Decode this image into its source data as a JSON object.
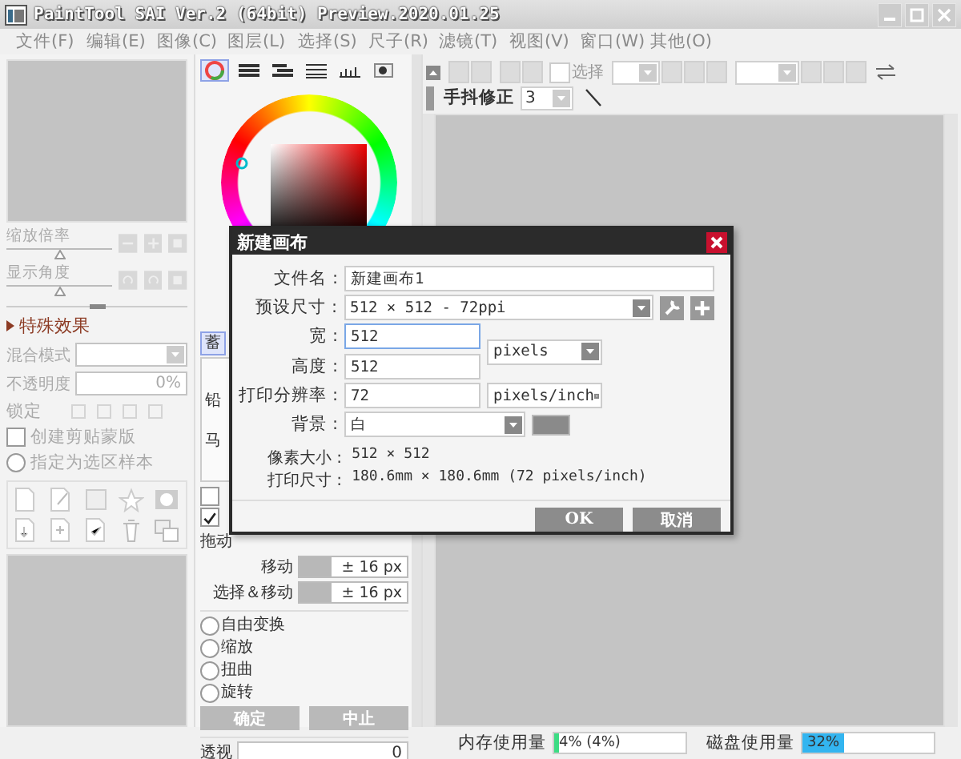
{
  "window": {
    "title": "PaintTool SAI Ver.2 (64bit) Preview.2020.01.25"
  },
  "menu": [
    "文件(F)",
    "编辑(E)",
    "图像(C)",
    "图层(L)",
    "选择(S)",
    "尺子(R)",
    "滤镜(T)",
    "视图(V)",
    "窗口(W)",
    "其他(O)"
  ],
  "navigator": {
    "sliders": [
      {
        "label": "缩放倍率",
        "level": 0.5
      },
      {
        "label": "显示角度",
        "level": 0.5
      }
    ]
  },
  "layer_panel": {
    "section": "特殊效果",
    "blend_label": "混合模式",
    "opacity_label": "不透明度",
    "opacity_value": "0%",
    "lock_label": "锁定",
    "options": [
      {
        "kind": "checkbox",
        "label": "创建剪贴蒙版",
        "checked": false
      },
      {
        "kind": "radio",
        "label": "指定为选区样本",
        "checked": false
      }
    ]
  },
  "color_panel": {
    "modes": [
      {
        "selected": true
      },
      {
        "selected": false
      },
      {
        "selected": false
      },
      {
        "selected": false
      },
      {
        "selected": false
      },
      {
        "selected": false
      }
    ]
  },
  "tool_panel": {
    "tab": "蓄",
    "tools": [
      "铅",
      "马"
    ]
  },
  "transform": {
    "options": [
      {
        "checked": false
      },
      {
        "checked": true
      }
    ],
    "drag_label": "拖动",
    "moves": [
      {
        "label": "移动",
        "value": "± 16 px",
        "level": 0.3
      },
      {
        "label": "选择＆移动",
        "value": "± 16 px",
        "level": 0.3
      }
    ],
    "modes": [
      {
        "label": "自由变换",
        "selected": false
      },
      {
        "label": "缩放",
        "selected": false
      },
      {
        "label": "扭曲",
        "selected": false
      },
      {
        "label": "旋转",
        "selected": false
      }
    ],
    "buttons": [
      "确定",
      "中止"
    ],
    "perspective": {
      "label": "透视",
      "value": "0"
    }
  },
  "toolbar": {
    "select_checked": false,
    "select_label": "选择",
    "stabilizer_label": "手抖修正",
    "stabilizer_value": "3"
  },
  "dialog": {
    "title": "新建画布",
    "file_name": {
      "label": "文件名 :",
      "value": "新建画布1"
    },
    "preset": {
      "label": "预设尺寸 :",
      "value": "512 × 512 - 72ppi"
    },
    "width": {
      "label": "宽 :",
      "value": "512"
    },
    "height": {
      "label": "高度 :",
      "value": "512"
    },
    "size_unit": "pixels",
    "resolution": {
      "label": "打印分辨率 :",
      "value": "72",
      "unit": "pixels/inch"
    },
    "background": {
      "label": "背景 :",
      "value": "白"
    },
    "info": [
      {
        "label": "像素大小 :",
        "value": "512 × 512"
      },
      {
        "label": "打印尺寸 :",
        "value": "180.6mm × 180.6mm (72 pixels/inch)"
      }
    ],
    "buttons": [
      "OK",
      "取消"
    ]
  },
  "status": {
    "memory": {
      "label": "内存使用量",
      "reading": "4% (4%)",
      "level": 0.04
    },
    "disk": {
      "label": "磁盘使用量",
      "reading": "32%",
      "level": 0.32
    }
  }
}
